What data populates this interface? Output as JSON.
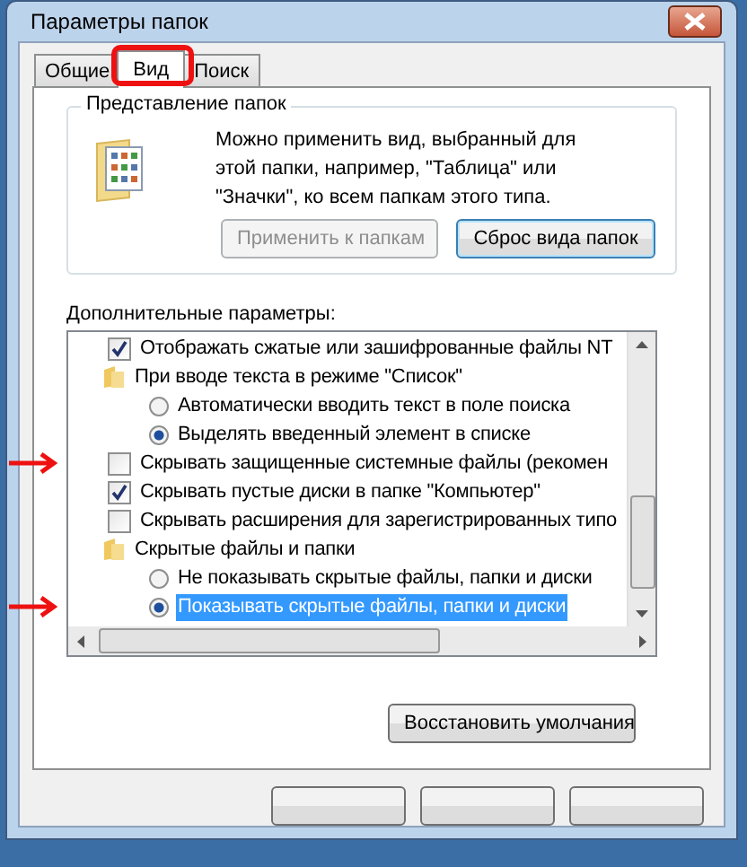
{
  "window": {
    "title": "Параметры папок"
  },
  "tabs": [
    {
      "label": "Общие",
      "selected": false
    },
    {
      "label": "Вид",
      "selected": true,
      "annotated": true
    },
    {
      "label": "Поиск",
      "selected": false
    }
  ],
  "folder_views": {
    "title": "Представление папок",
    "description": "Можно применить вид, выбранный для этой папки, например, \"Таблица\" или \"Значки\", ко всем папкам этого типа.",
    "buttons": [
      {
        "label": "Применить к папкам",
        "disabled": true
      },
      {
        "label": "Сброс вида папок",
        "disabled": false
      }
    ]
  },
  "advanced": {
    "label": "Дополнительные параметры:",
    "items": [
      {
        "kind": "checkbox",
        "label": "Отображать сжатые или зашифрованные файлы NT",
        "checked": true
      },
      {
        "kind": "folder",
        "label": "При вводе текста в режиме \"Список\"",
        "children": [
          {
            "kind": "radio",
            "label": "Автоматически вводить текст в поле поиска",
            "selected": false,
            "highlighted": false
          },
          {
            "kind": "radio",
            "label": "Выделять введенный элемент в списке",
            "selected": true,
            "highlighted": false
          }
        ]
      },
      {
        "kind": "checkbox",
        "label": "Скрывать защищенные системные файлы (рекомен",
        "checked": false,
        "annotated": true
      },
      {
        "kind": "checkbox",
        "label": "Скрывать пустые диски в папке \"Компьютер\"",
        "checked": true
      },
      {
        "kind": "checkbox",
        "label": "Скрывать расширения для зарегистрированных типо",
        "checked": false
      },
      {
        "kind": "folder",
        "label": "Скрытые файлы и папки",
        "children": [
          {
            "kind": "radio",
            "label": "Не показывать скрытые файлы, папки и диски",
            "selected": false,
            "highlighted": false
          },
          {
            "kind": "radio",
            "label": "Показывать скрытые файлы, папки и диски",
            "selected": true,
            "highlighted": true,
            "annotated": true
          }
        ]
      }
    ]
  },
  "restore_button": "Восстановить умолчания"
}
